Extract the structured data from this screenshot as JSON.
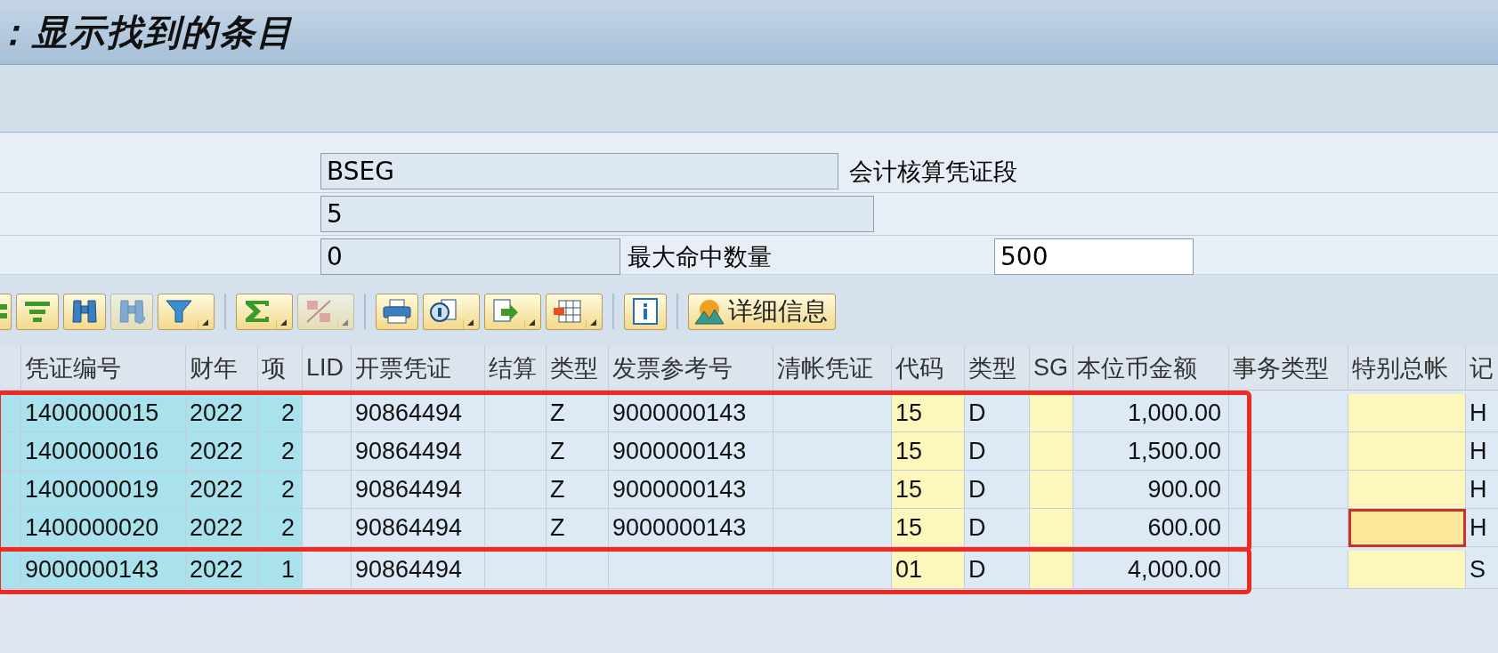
{
  "window": {
    "title": "：显示找到的条目"
  },
  "form": [
    {
      "value": "BSEG",
      "editable": false,
      "description": "会计核算凭证段"
    },
    {
      "value": "5",
      "editable": false
    },
    {
      "value": "0",
      "editable": false,
      "extra_label": "最大命中数量",
      "extra_value": "500",
      "extra_editable": true
    }
  ],
  "toolbar": [
    {
      "kind": "icon",
      "dropdown": false,
      "disabled": false
    },
    {
      "kind": "icon",
      "dropdown": false,
      "disabled": false
    },
    {
      "kind": "icon",
      "dropdown": false,
      "disabled": false
    },
    {
      "kind": "icon",
      "dropdown": false,
      "disabled": true
    },
    {
      "kind": "icon",
      "dropdown": true,
      "disabled": false
    },
    {
      "kind": "separator"
    },
    {
      "kind": "icon",
      "dropdown": true,
      "disabled": false
    },
    {
      "kind": "icon",
      "dropdown": true,
      "disabled": true
    },
    {
      "kind": "separator"
    },
    {
      "kind": "icon",
      "dropdown": false,
      "disabled": false
    },
    {
      "kind": "icon",
      "dropdown": true,
      "disabled": false
    },
    {
      "kind": "icon",
      "dropdown": true,
      "disabled": false
    },
    {
      "kind": "icon",
      "dropdown": true,
      "disabled": false
    },
    {
      "kind": "separator"
    },
    {
      "kind": "icon",
      "dropdown": false,
      "disabled": false
    },
    {
      "kind": "separator"
    },
    {
      "kind": "text",
      "label": "详细信息"
    }
  ],
  "table": {
    "columns": [
      {
        "kind": "key"
      },
      {
        "label": "凭证编号",
        "kind": "key"
      },
      {
        "label": "财年",
        "kind": "key"
      },
      {
        "label": "项",
        "kind": "key"
      },
      {
        "label": "LID",
        "kind": "normal"
      },
      {
        "label": "开票凭证",
        "kind": "normal"
      },
      {
        "label": "结算",
        "kind": "normal"
      },
      {
        "label": "类型",
        "kind": "normal"
      },
      {
        "label": "发票参考号",
        "kind": "normal"
      },
      {
        "label": "清帐凭证",
        "kind": "normal"
      },
      {
        "label": "代码",
        "kind": "input"
      },
      {
        "label": "类型",
        "kind": "normal"
      },
      {
        "label": "SG",
        "kind": "input"
      },
      {
        "label": "本位币金额",
        "kind": "normal"
      },
      {
        "label": "事务类型",
        "kind": "normal"
      },
      {
        "label": "特别总帐",
        "kind": "input"
      },
      {
        "label": "记",
        "kind": "normal"
      }
    ],
    "row_groups": [
      {
        "highlighted": true,
        "rows": [
          {
            "focused": false,
            "cells": [
              null,
              "1400000015",
              "2022",
              "2",
              null,
              "90864494",
              null,
              "Z",
              "9000000143",
              null,
              "15",
              "D",
              null,
              "1,000.00",
              null,
              null,
              "H"
            ]
          },
          {
            "focused": false,
            "cells": [
              null,
              "1400000016",
              "2022",
              "2",
              null,
              "90864494",
              null,
              "Z",
              "9000000143",
              null,
              "15",
              "D",
              null,
              "1,500.00",
              null,
              null,
              "H"
            ]
          },
          {
            "focused": false,
            "cells": [
              null,
              "1400000019",
              "2022",
              "2",
              null,
              "90864494",
              null,
              "Z",
              "9000000143",
              null,
              "15",
              "D",
              null,
              "900.00",
              null,
              null,
              "H"
            ]
          },
          {
            "focused": true,
            "cells": [
              null,
              "1400000020",
              "2022",
              "2",
              null,
              "90864494",
              null,
              "Z",
              "9000000143",
              null,
              "15",
              "D",
              null,
              "600.00",
              null,
              null,
              "H"
            ]
          }
        ]
      },
      {
        "highlighted": true,
        "rows": [
          {
            "focused": false,
            "cells": [
              null,
              "9000000143",
              "2022",
              "1",
              null,
              "90864494",
              null,
              null,
              null,
              null,
              "01",
              "D",
              null,
              "4,000.00",
              null,
              null,
              "S"
            ]
          }
        ]
      }
    ]
  }
}
